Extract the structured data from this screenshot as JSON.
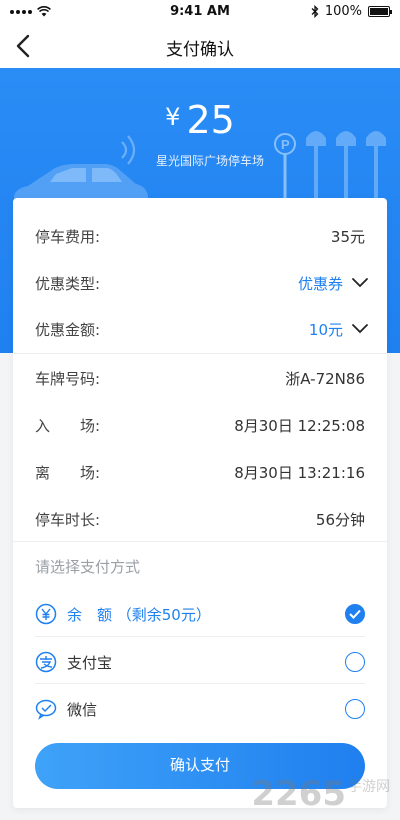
{
  "status": {
    "time": "9:41 AM",
    "battery": "100%"
  },
  "nav": {
    "title": "支付确认"
  },
  "hero": {
    "currency": "¥",
    "amount": "25",
    "station": "星光国际广场停车场"
  },
  "fees": [
    {
      "label": "停车费用:",
      "value": "35元"
    },
    {
      "label": "优惠类型:",
      "value": "优惠券"
    },
    {
      "label": "优惠金额:",
      "value": "10元"
    }
  ],
  "details": [
    {
      "label": "车牌号码:",
      "value": "浙A-72N86"
    },
    {
      "label": "入　　场:",
      "value": "8月30日 12:25:08"
    },
    {
      "label": "离　　场:",
      "value": "8月30日 13:21:16"
    },
    {
      "label": "停车时长:",
      "value": "56分钟"
    }
  ],
  "payment": {
    "title": "请选择支付方式",
    "methods": [
      {
        "label": "余　额 （剩余50元）",
        "icon": "yuan-icon",
        "selected": true
      },
      {
        "label": "支付宝",
        "icon": "alipay-icon",
        "selected": false
      },
      {
        "label": "微信",
        "icon": "wechat-icon",
        "selected": false
      }
    ]
  },
  "confirm": {
    "label": "确认支付"
  },
  "watermark": {
    "brand": "2265",
    "suffix": "手游网"
  },
  "colors": {
    "primary": "#1f80f0",
    "hero_bg": "#2a8cf5"
  }
}
